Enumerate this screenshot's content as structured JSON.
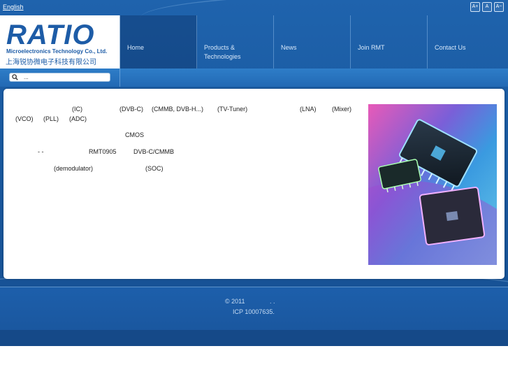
{
  "topbar": {
    "language_link": "English",
    "font_buttons": [
      "A+",
      "A",
      "A−"
    ]
  },
  "logo": {
    "wordmark": "RATIO",
    "subtitle_en": "Microelectronics Technology Co., Ltd.",
    "subtitle_cn": "上海锐协微电子科技有限公司"
  },
  "nav": {
    "items": [
      {
        "label": "Home"
      },
      {
        "label": "Products &\nTechnologies"
      },
      {
        "label": "News"
      },
      {
        "label": "Join RMT"
      },
      {
        "label": "Contact Us"
      }
    ]
  },
  "search": {
    "value": "...",
    "icon": "search-icon"
  },
  "content": {
    "line1": [
      "(IC)",
      "(DVB-C)",
      "(CMMB, DVB-H...)",
      "(TV-Tuner)",
      "(LNA)",
      "(Mixer)"
    ],
    "line2": [
      "(VCO)",
      "(PLL)",
      "(ADC)"
    ],
    "line3": [
      "CMOS"
    ],
    "line4": [
      "- -",
      "RMT0905",
      "DVB-C/CMMB"
    ],
    "line5": [
      "(demodulator)",
      "(SOC)"
    ]
  },
  "footer": {
    "copyright": "© 2011",
    "dots": ".   .",
    "icp": "ICP 10007635."
  },
  "colors": {
    "accent": "#1d5ca7",
    "background": "#1a5aa0",
    "nav_text": "#d8e8fa"
  }
}
